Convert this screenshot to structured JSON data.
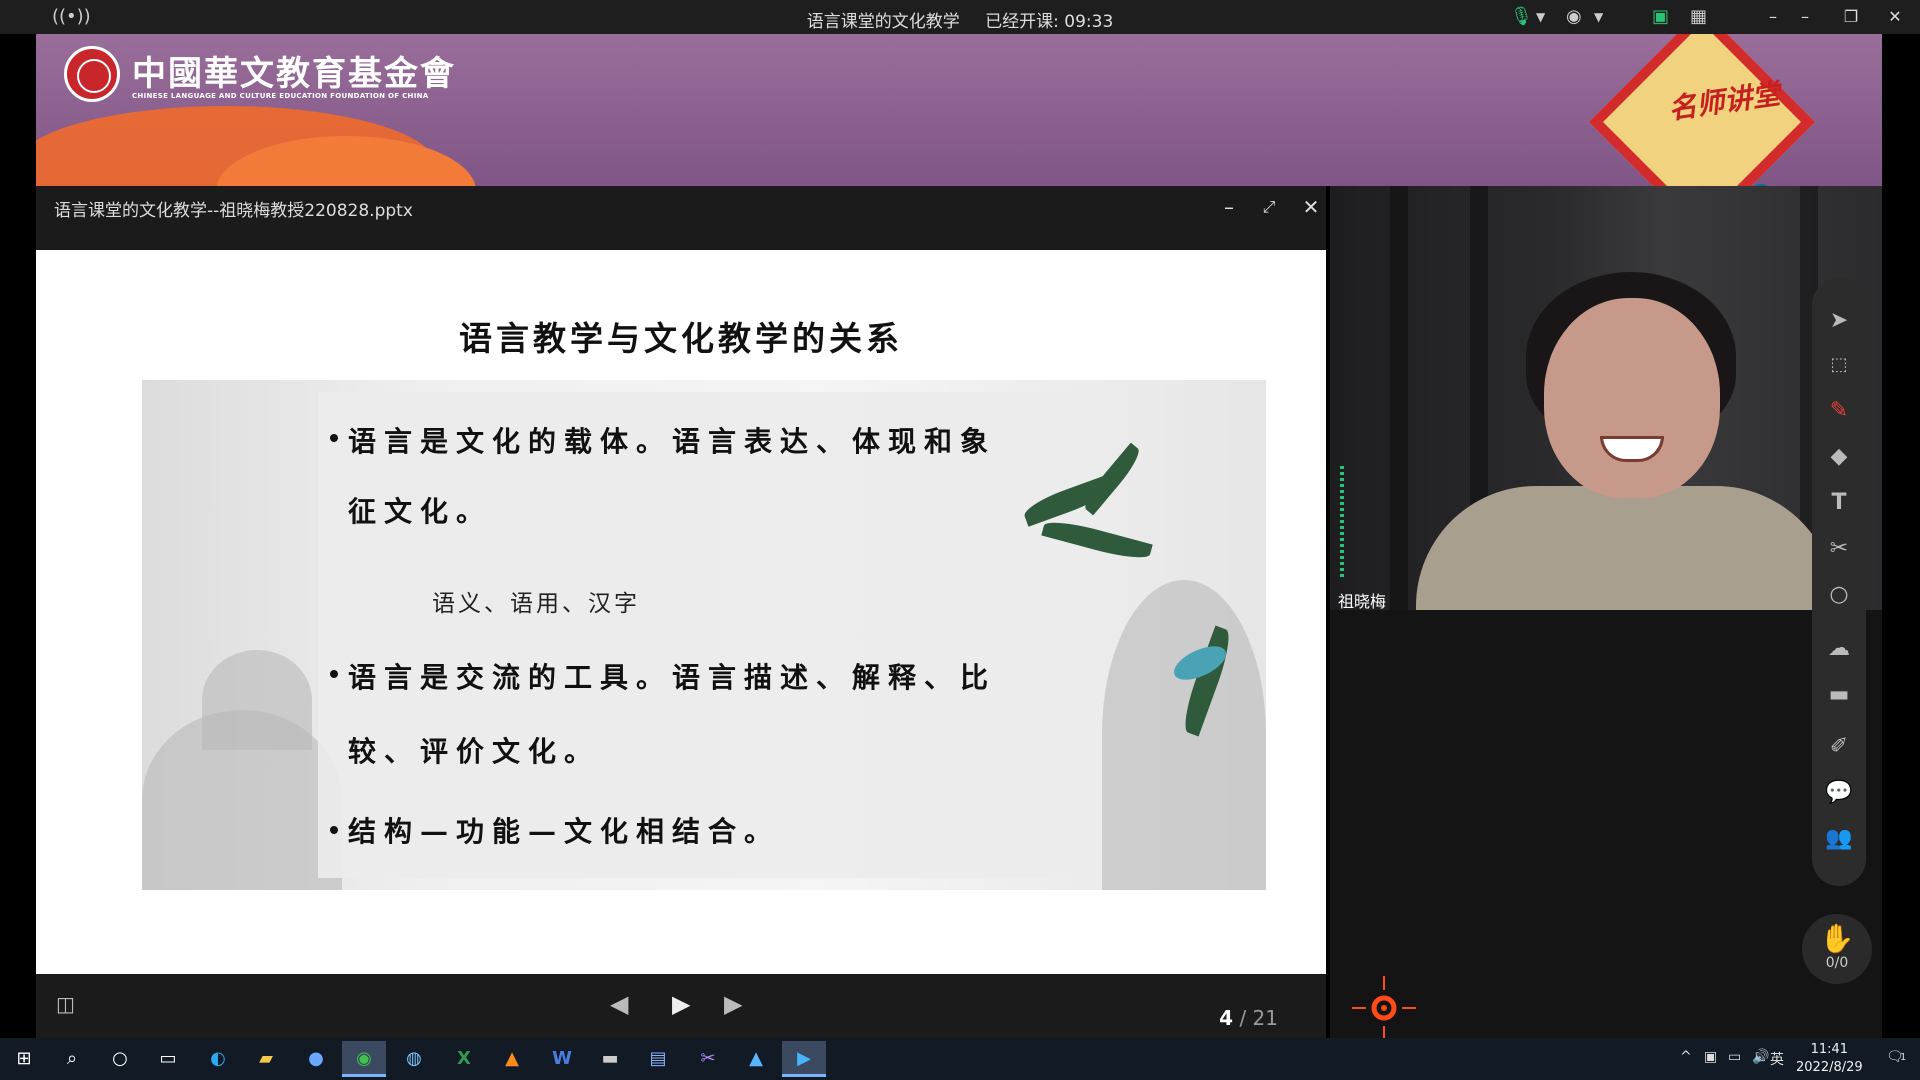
{
  "titlebar": {
    "meeting_title": "语言课堂的文化教学",
    "elapsed_label": "已经开课: 09:33"
  },
  "banner": {
    "org_name_cn": "中國華文教育基金會",
    "org_name_en": "CHINESE LANGUAGE AND CULTURE EDUCATION FOUNDATION OF CHINA",
    "badge_text": "名师讲堂",
    "brand_colors": {
      "banner": "#8a5f8e",
      "accent": "#f06a2c",
      "badge": "#d32b2b"
    }
  },
  "document": {
    "file_name": "语言课堂的文化教学--祖晓梅教授220828.pptx",
    "slide": {
      "heading": "语言教学与文化教学的关系",
      "bullets": [
        {
          "line1": "语言是文化的载体。语言表达、体现和象",
          "line2": "征文化。"
        },
        {
          "line1": "语言是交流的工具。语言描述、解释、比",
          "line2": "较、评价文化。"
        },
        {
          "line1": "结构—功能—文化相结合。"
        }
      ],
      "sub_point": "语义、语用、汉字"
    },
    "pager": {
      "current": "4",
      "total": "21"
    }
  },
  "video": {
    "participant_name": "祖晓梅"
  },
  "toolbar": {
    "tools": [
      "cursor-icon",
      "select-icon",
      "pen-icon",
      "eraser-icon",
      "text-icon",
      "scissors-icon",
      "shape-icon",
      "cloud-icon",
      "toolbox-icon",
      "edit-icon",
      "chat-icon",
      "users-icon"
    ],
    "hand_count": "0/0"
  },
  "taskbar": {
    "ime": "英",
    "time": "11:41",
    "date": "2022/8/29",
    "notifications": "1"
  }
}
